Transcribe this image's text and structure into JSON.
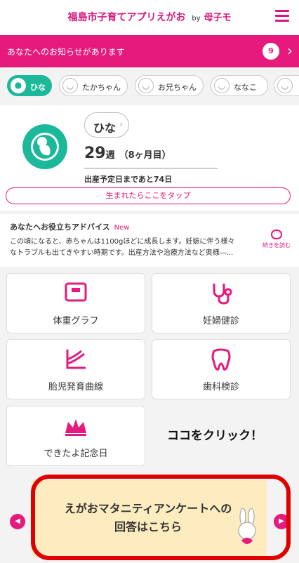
{
  "header": {
    "title": "福島市子育てアプリえがお",
    "by": "by",
    "brand": "母子モ",
    "menu_icon": "hamburger-icon"
  },
  "notice": {
    "text": "あなたへのお知らせがあります",
    "count": "9",
    "arrow": "›"
  },
  "children_tabs": [
    {
      "label": "ひな",
      "active": true
    },
    {
      "label": "たかちゃん",
      "active": false
    },
    {
      "label": "お兄ちゃん",
      "active": false
    },
    {
      "label": "ななこ",
      "active": false
    }
  ],
  "profile": {
    "name": "ひな",
    "weeks": "29",
    "weeks_unit": "週",
    "months": "（8ヶ月目）",
    "due": "出産予定日まであと74日",
    "tap_button": "生まれたらここをタップ"
  },
  "advice": {
    "title": "あなたへお役立ちアドバイス",
    "new": "New",
    "body_line1": "この頃になると、赤ちゃんは1100gほどに成長します。妊娠に伴う様々",
    "body_line2": "なトラブルも出てきやすい時期です。出産方法や治療方法など奥様―...",
    "more": "続きを読む"
  },
  "menu_cards": [
    {
      "label": "体重グラフ",
      "icon": "scale-icon"
    },
    {
      "label": "妊婦健診",
      "icon": "stethoscope-icon"
    },
    {
      "label": "胎児発育曲線",
      "icon": "growth-curve-icon"
    },
    {
      "label": "歯科検診",
      "icon": "tooth-icon"
    },
    {
      "label": "できたよ記念日",
      "icon": "crown-icon"
    }
  ],
  "callout": "ココをクリック！",
  "banner": {
    "line1": "えがおマタニティアンケートへの",
    "line2": "回答はこちら"
  },
  "colors": {
    "brand": "#e6197d",
    "accent_green": "#1bb99a",
    "highlight": "#e00000"
  }
}
